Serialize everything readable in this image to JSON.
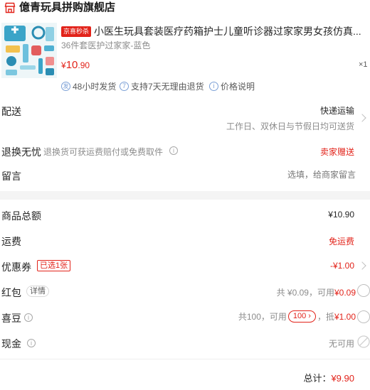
{
  "shop": {
    "name": "億青玩具拼购旗舰店"
  },
  "product": {
    "promo_tag": "京喜秒杀",
    "title": "小医生玩具套装医疗药箱护士儿童听诊器过家家男女孩仿真...",
    "spec": "36件套医护过家家-蓝色",
    "price_symbol": "¥",
    "price_int": "10",
    "price_dec": ".90",
    "quantity": "×1",
    "badges": [
      {
        "icon": "发",
        "label": "48小时发货"
      },
      {
        "icon": "7",
        "label": "支持7天无理由退货"
      },
      {
        "icon": "i",
        "label": "价格说明"
      }
    ]
  },
  "delivery": {
    "label": "配送",
    "method": "快递运输",
    "detail": "工作日、双休日与节假日均可送货"
  },
  "exchange": {
    "label": "退换无忧",
    "desc": "退换货可获运费赔付或免费取件",
    "value": "卖家赠送"
  },
  "message": {
    "label": "留言",
    "placeholder": "选填，给商家留言"
  },
  "summary": {
    "goods_total": {
      "label": "商品总额",
      "value": "¥10.90"
    },
    "shipping": {
      "label": "运费",
      "value": "免运费"
    },
    "coupon": {
      "label": "优惠券",
      "badge": "已选1张",
      "value": "-¥1.00"
    },
    "red_packet": {
      "label": "红包",
      "detail_btn": "详情",
      "total": "共 ¥0.09，可用",
      "usable": "¥0.09"
    },
    "jingdou": {
      "label": "喜豆",
      "total": "共100，可用",
      "pill": "100 ›",
      "deduct_label": "，抵",
      "deduct_value": "¥1.00"
    },
    "cash": {
      "label": "现金",
      "value": "无可用"
    }
  },
  "footer": {
    "total_label": "总计：",
    "total_value": "¥9.90"
  },
  "colors": {
    "accent": "#e2231a",
    "band": "#f4f4f4"
  }
}
